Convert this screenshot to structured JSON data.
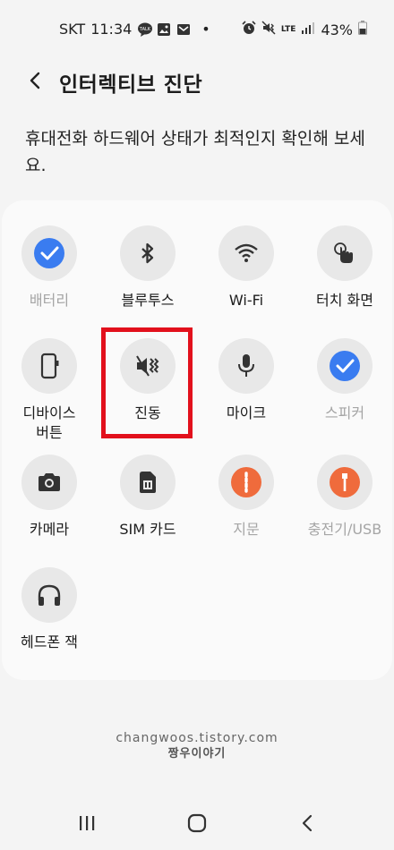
{
  "status_bar": {
    "carrier": "SKT",
    "time": "11:34",
    "dot": "•",
    "network": "LTE",
    "battery": "43%"
  },
  "header": {
    "title": "인터렉티브 진단",
    "back_icon": "chevron-left-icon"
  },
  "description": "휴대전화 하드웨어 상태가 최적인지 확인해 보세요.",
  "tests": [
    {
      "label": "배터리",
      "icon": "check-circle-icon",
      "dim": true
    },
    {
      "label": "블루투스",
      "icon": "bluetooth-icon",
      "dim": false
    },
    {
      "label": "Wi-Fi",
      "icon": "wifi-icon",
      "dim": false
    },
    {
      "label": "터치 화면",
      "icon": "touch-icon",
      "dim": false
    },
    {
      "label": "디바이스\n버튼",
      "icon": "device-button-icon",
      "dim": false
    },
    {
      "label": "진동",
      "icon": "vibration-icon",
      "dim": false
    },
    {
      "label": "마이크",
      "icon": "microphone-icon",
      "dim": false
    },
    {
      "label": "스피커",
      "icon": "check-circle-icon",
      "dim": true
    },
    {
      "label": "카메라",
      "icon": "camera-icon",
      "dim": false
    },
    {
      "label": "SIM 카드",
      "icon": "sim-card-icon",
      "dim": false
    },
    {
      "label": "지문",
      "icon": "fingerprint-icon",
      "dim": true
    },
    {
      "label": "충전기/USB",
      "icon": "charger-icon",
      "dim": true
    },
    {
      "label": "헤드폰 잭",
      "icon": "headphones-icon",
      "dim": false
    }
  ],
  "watermark": {
    "line1": "changwoos.tistory.com",
    "line2": "짱우이야기"
  },
  "colors": {
    "accent_blue": "#3a7cf0",
    "highlight_red": "#e2101c",
    "disabled_orange": "#ef6b3c"
  }
}
